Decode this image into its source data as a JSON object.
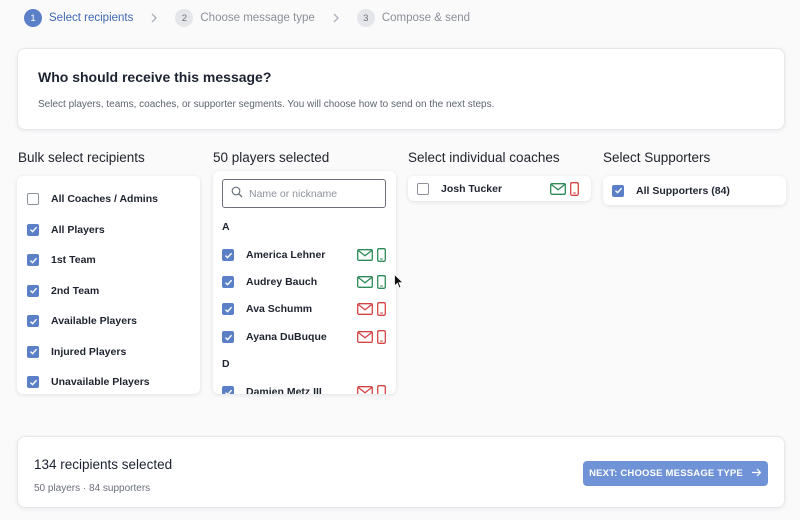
{
  "stepper": {
    "steps": [
      {
        "num": "1",
        "label": "Select recipients"
      },
      {
        "num": "2",
        "label": "Choose message type"
      },
      {
        "num": "3",
        "label": "Compose & send"
      }
    ]
  },
  "header": {
    "title": "Who should receive this message?",
    "subtitle": "Select players, teams, coaches, or supporter segments. You will choose how to send on the next steps."
  },
  "columns": {
    "bulk_title": "Bulk select recipients",
    "players_title": "50 players selected",
    "coaches_title": "Select individual coaches",
    "supporters_title": "Select Supporters"
  },
  "bulk": {
    "items": [
      {
        "label": "All Coaches / Admins",
        "checked": false
      },
      {
        "label": "All Players",
        "checked": true
      },
      {
        "label": "1st Team",
        "checked": true
      },
      {
        "label": "2nd Team",
        "checked": true
      },
      {
        "label": "Available Players",
        "checked": true
      },
      {
        "label": "Injured Players",
        "checked": true
      },
      {
        "label": "Unavailable Players",
        "checked": true
      }
    ]
  },
  "players": {
    "search_placeholder": "Name or nickname",
    "groups": [
      {
        "letter": "A",
        "items": [
          {
            "name": "America Lehner",
            "checked": true,
            "contact_status": "valid"
          },
          {
            "name": "Audrey Bauch",
            "checked": true,
            "contact_status": "valid"
          },
          {
            "name": "Ava Schumm",
            "checked": true,
            "contact_status": "missing"
          },
          {
            "name": "Ayana DuBuque",
            "checked": true,
            "contact_status": "missing"
          }
        ]
      },
      {
        "letter": "D",
        "items": [
          {
            "name": "Damien Metz III",
            "checked": true,
            "contact_status": "missing"
          }
        ]
      }
    ]
  },
  "coaches": {
    "items": [
      {
        "name": "Josh Tucker",
        "checked": false,
        "email_status": "valid",
        "phone_status": "missing"
      }
    ]
  },
  "supporters": {
    "items": [
      {
        "label": "All Supporters (84)",
        "checked": true
      }
    ]
  },
  "footer": {
    "count": "134 recipients selected",
    "breakdown": "50 players · 84 supporters",
    "next_label": "NEXT: CHOOSE MESSAGE TYPE"
  },
  "colors": {
    "accent": "#5b80c8",
    "valid": "#2e8b57",
    "missing": "#d64545"
  }
}
